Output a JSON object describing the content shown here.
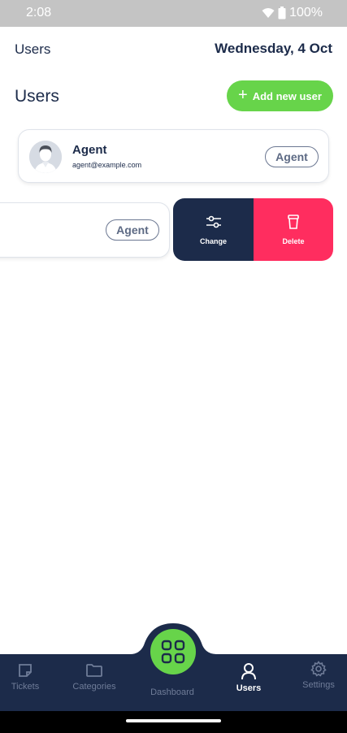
{
  "status_bar": {
    "time": "2:08",
    "battery": "100%",
    "wifi_icon": "wifi-icon",
    "battery_icon": "battery-icon"
  },
  "header": {
    "title": "Users",
    "date": "Wednesday, 4 Oct"
  },
  "section": {
    "title": "Users",
    "add_button_label": "Add new user",
    "add_icon": "plus-icon"
  },
  "users": [
    {
      "name": "Agent",
      "email": "agent@example.com",
      "role": "Agent",
      "avatar_icon": "person-avatar-icon"
    },
    {
      "name": "",
      "email": "",
      "role": "Agent"
    }
  ],
  "row_actions": {
    "change_label": "Change",
    "delete_label": "Delete",
    "change_icon": "sliders-icon",
    "delete_icon": "trash-icon"
  },
  "bottom_nav": {
    "items": [
      {
        "label": "Tickets",
        "icon": "note-icon"
      },
      {
        "label": "Categories",
        "icon": "folder-icon"
      },
      {
        "label": "Dashboard",
        "icon": "grid-icon"
      },
      {
        "label": "Users",
        "icon": "user-icon",
        "active": true
      },
      {
        "label": "Settings",
        "icon": "gear-icon"
      }
    ]
  },
  "colors": {
    "navy": "#1c2b4a",
    "green": "#67d44a",
    "red": "#ff2d5f",
    "muted": "#6f7c98"
  }
}
